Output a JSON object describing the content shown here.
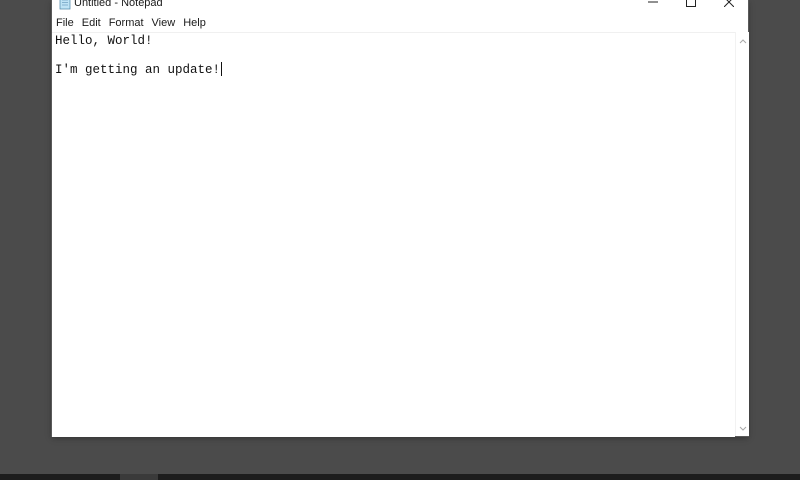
{
  "window": {
    "title": "Untitled - Notepad",
    "controls": {
      "minimize_icon": "minimize-icon",
      "maximize_icon": "maximize-icon",
      "close_icon": "close-icon"
    }
  },
  "menubar": {
    "items": [
      "File",
      "Edit",
      "Format",
      "View",
      "Help"
    ]
  },
  "editor": {
    "lines": [
      "Hello, World!",
      "",
      "I'm getting an update!"
    ]
  },
  "colors": {
    "desktop": "#4b4b4b",
    "window": "#ffffff",
    "taskbar": "#1d1d1d"
  }
}
